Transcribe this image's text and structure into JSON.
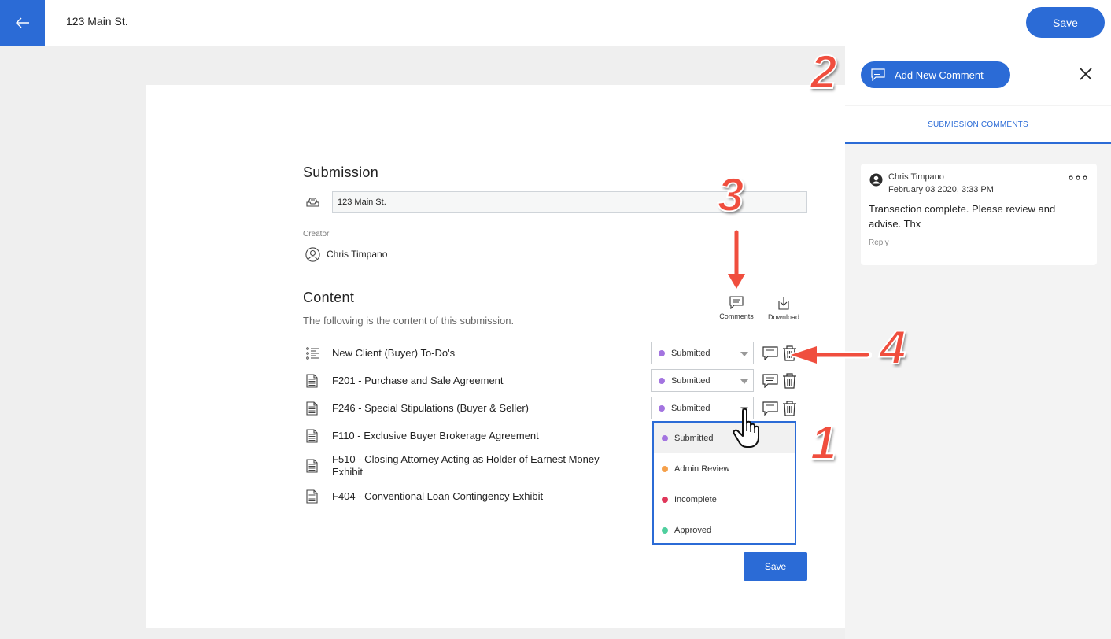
{
  "topbar": {
    "back_icon": "arrow-left-icon",
    "title": "123 Main St.",
    "save_label": "Save"
  },
  "submission": {
    "heading": "Submission",
    "icon": "inbox-icon",
    "name_value": "123 Main St.",
    "creator_label": "Creator",
    "creator_name": "Chris Timpano"
  },
  "content": {
    "heading": "Content",
    "subtitle": "The following is the content of this submission.",
    "tools": {
      "comments_label": "Comments",
      "download_label": "Download"
    },
    "rows": [
      {
        "icon": "checklist-icon",
        "label": "New Client (Buyer) To-Do's",
        "status": "Submitted"
      },
      {
        "icon": "document-icon",
        "label": "F201 - Purchase and Sale Agreement",
        "status": "Submitted"
      },
      {
        "icon": "document-icon",
        "label": "F246 - Special Stipulations (Buyer & Seller)",
        "status": "Submitted"
      },
      {
        "icon": "document-icon",
        "label": "F110 - Exclusive Buyer Brokerage Agreement"
      },
      {
        "icon": "document-icon",
        "label": "F510 - Closing Attorney Acting as Holder of Earnest Money Exhibit"
      },
      {
        "icon": "document-icon",
        "label": "F404 - Conventional Loan Contingency Exhibit"
      }
    ],
    "status_options": [
      {
        "label": "Submitted",
        "color": "#a374e0"
      },
      {
        "label": "Admin Review",
        "color": "#f5a04a"
      },
      {
        "label": "Incomplete",
        "color": "#e0375a"
      },
      {
        "label": "Approved",
        "color": "#4fcf9e"
      }
    ],
    "save_label": "Save"
  },
  "panel": {
    "add_comment_label": "Add New Comment",
    "close_icon": "close-icon",
    "tab_label": "SUBMISSION COMMENTS",
    "comment": {
      "author": "Chris Timpano",
      "date": "February 03 2020, 3:33 PM",
      "text": "Transaction complete. Please review and advise. Thx",
      "reply_label": "Reply"
    }
  },
  "annotations": {
    "one": "1",
    "two": "2",
    "three": "3",
    "four": "4",
    "color": "#f04e3e"
  }
}
